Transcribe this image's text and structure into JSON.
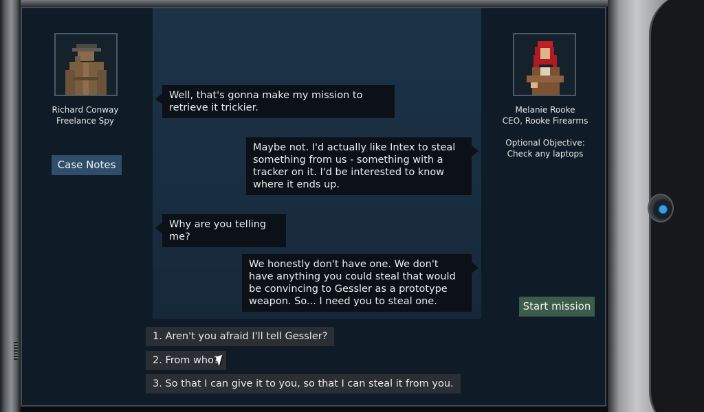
{
  "left_character": {
    "name": "Richard Conway",
    "title": "Freelance Spy",
    "portrait_icon": "trenchcoat-spy-portrait"
  },
  "right_character": {
    "name": "Melanie Rooke",
    "title": "CEO, Rooke Firearms",
    "objective_label": "Optional Objective:",
    "objective_text": "Check any laptops",
    "portrait_icon": "red-haired-ceo-portrait"
  },
  "buttons": {
    "case_notes": "Case Notes",
    "start_mission": "Start mission"
  },
  "dialogue": [
    {
      "speaker": "left",
      "text": "Well, that's gonna make my mission to retrieve it trickier."
    },
    {
      "speaker": "right",
      "text": "Maybe not. I'd actually like Intex to steal something from us - something with a tracker on it. I'd be interested to know where it ends up."
    },
    {
      "speaker": "left",
      "text": "Why are you telling me?"
    },
    {
      "speaker": "right",
      "text": "We honestly don't have one. We don't have anything you could steal that would be convincing to Gessler as a prototype weapon. So... I need you to steal one."
    }
  ],
  "options": [
    {
      "label": "1. Aren't you afraid I'll tell Gessler?"
    },
    {
      "label": "2. From who?"
    },
    {
      "label": "3. So that I can give it to you, so that I can steal it from you."
    }
  ],
  "colors": {
    "panel": "#0f1c27",
    "log": "#1c3347",
    "bubble": "#0c1117",
    "case_notes_button": "#2e4e6c",
    "start_button": "#3a5c48",
    "option": "#2b2f33"
  }
}
